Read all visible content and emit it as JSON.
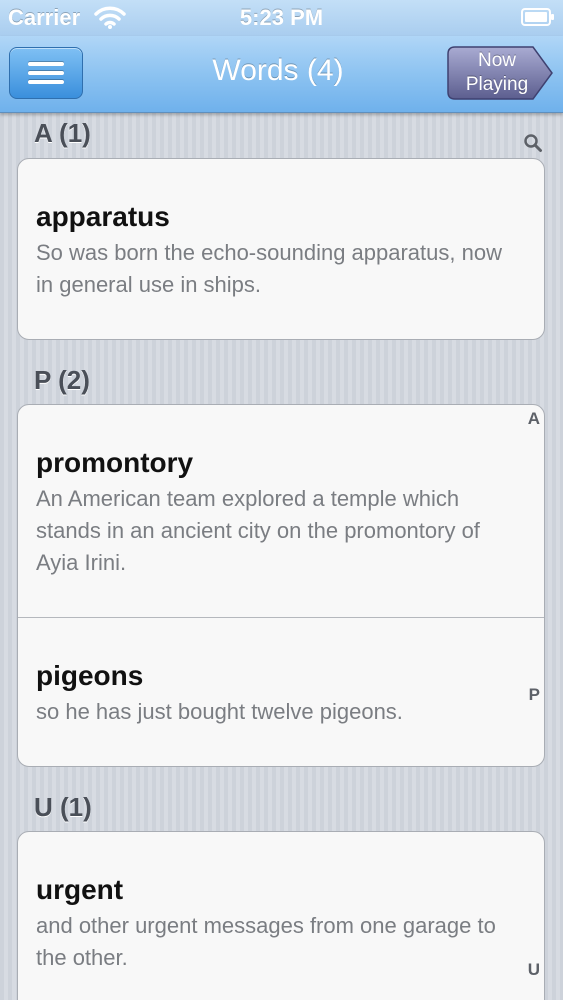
{
  "status_bar": {
    "carrier": "Carrier",
    "time": "5:23 PM",
    "wifi_icon": "wifi-icon",
    "battery_icon": "battery-icon"
  },
  "nav_bar": {
    "menu_icon": "hamburger-menu-icon",
    "title": "Words (4)",
    "now_playing_line1": "Now",
    "now_playing_line2": "Playing"
  },
  "sections": [
    {
      "header": "A (1)",
      "items": [
        {
          "word": "apparatus",
          "example": "So was born the echo-sounding apparatus, now in general use in ships."
        }
      ]
    },
    {
      "header": "P (2)",
      "items": [
        {
          "word": "promontory",
          "example": "An American team explored a temple which stands in an ancient city on the promontory of Ayia Irini."
        },
        {
          "word": "pigeons",
          "example": "so he has just bought twelve pigeons."
        }
      ]
    },
    {
      "header": "U (1)",
      "items": [
        {
          "word": "urgent",
          "example": "and other urgent messages from one garage to the other."
        }
      ]
    }
  ],
  "index": {
    "search_icon": "search-icon",
    "letters": [
      "A",
      "P",
      "U"
    ]
  },
  "colors": {
    "nav_accent": "#8dc3f1",
    "now_playing": "#6d6f9e",
    "word_text": "#111111",
    "example_text": "#7a7d82"
  }
}
